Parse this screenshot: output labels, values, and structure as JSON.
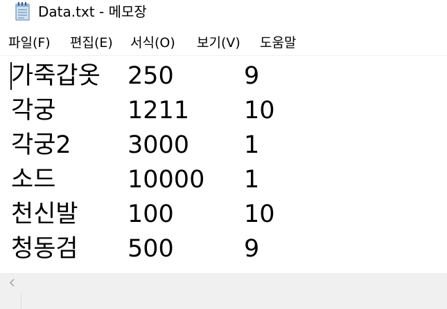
{
  "window": {
    "title": "Data.txt - 메모장"
  },
  "menu": [
    {
      "label": "파일(F)"
    },
    {
      "label": "편집(E)"
    },
    {
      "label": "서식(O)"
    },
    {
      "label": "보기(V)"
    },
    {
      "label": "도움말"
    }
  ],
  "editor": {
    "rows": [
      {
        "name": "가죽갑옷",
        "price": "250",
        "qty": "9"
      },
      {
        "name": "각궁",
        "price": "1211",
        "qty": "10"
      },
      {
        "name": "각궁2",
        "price": "3000",
        "qty": "1"
      },
      {
        "name": "소드",
        "price": "10000",
        "qty": "1"
      },
      {
        "name": "천신발",
        "price": "100",
        "qty": "10"
      },
      {
        "name": "청동검",
        "price": "500",
        "qty": "9"
      }
    ]
  },
  "icons": {
    "app": "notepad-icon",
    "scroll_left": "chevron-left-icon"
  }
}
